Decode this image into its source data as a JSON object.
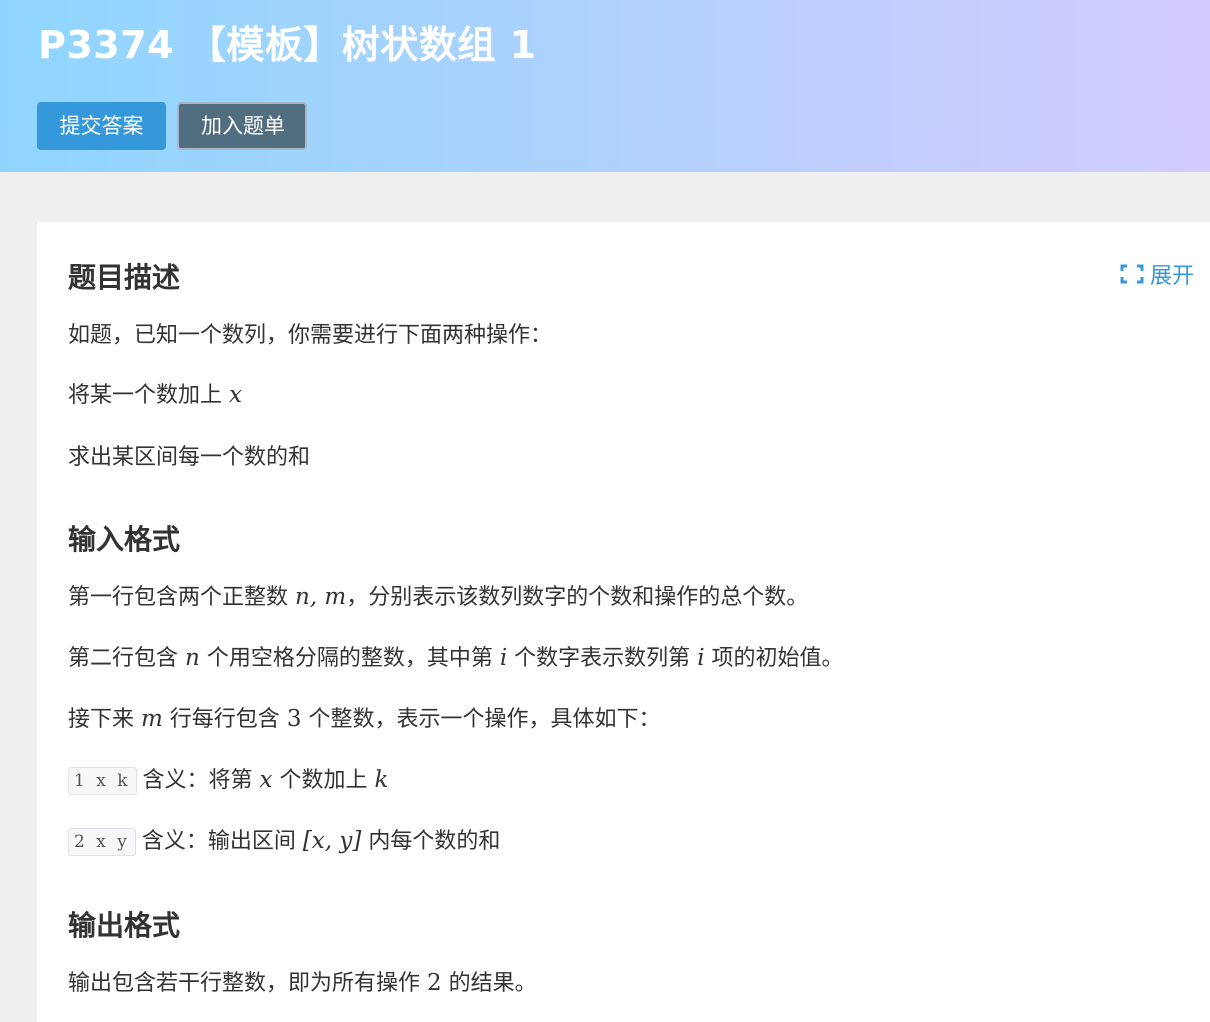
{
  "header": {
    "title": "P3374 【模板】树状数组 1",
    "submit_label": "提交答案",
    "add_label": "加入题单"
  },
  "card": {
    "expand_label": "展开",
    "sections": {
      "description": {
        "heading": "题目描述",
        "line1": "如题，已知一个数列，你需要进行下面两种操作：",
        "line2_text": "将某一个数加上 ",
        "line2_var": "x",
        "line3": "求出某区间每一个数的和"
      },
      "input": {
        "heading": "输入格式",
        "l1_a": "第一行包含两个正整数 ",
        "l1_var": "n, m",
        "l1_b": "，分别表示该数列数字的个数和操作的总个数。",
        "l2_a": "第二行包含 ",
        "l2_var1": "n",
        "l2_b": " 个用空格分隔的整数，其中第 ",
        "l2_var2": "i",
        "l2_c": " 个数字表示数列第 ",
        "l2_var3": "i",
        "l2_d": " 项的初始值。",
        "l3_a": "接下来 ",
        "l3_var1": "m",
        "l3_b": " 行每行包含 ",
        "l3_num": "3",
        "l3_c": " 个整数，表示一个操作，具体如下：",
        "op1_code": "1 x k",
        "op1_a": "含义：将第 ",
        "op1_var1": "x",
        "op1_b": " 个数加上 ",
        "op1_var2": "k",
        "op2_code": "2 x y",
        "op2_a": "含义：输出区间 ",
        "op2_math": "[x, y]",
        "op2_b": " 内每个数的和"
      },
      "output": {
        "heading": "输出格式",
        "l1_a": "输出包含若干行整数，即为所有操作 ",
        "l1_num": "2",
        "l1_b": " 的结果。"
      }
    }
  },
  "colors": {
    "accent": "#3498db",
    "secondary_button": "#516d80",
    "header_gradient_start": "#8fd6ff",
    "header_gradient_end": "#d2cbff"
  }
}
